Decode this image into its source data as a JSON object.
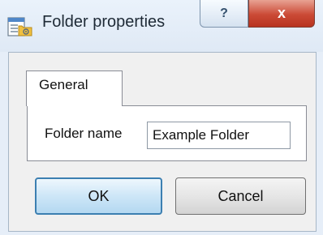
{
  "window": {
    "title": "Folder properties",
    "icon": "folder-properties-icon",
    "help_label": "?",
    "close_label": "x"
  },
  "tabs": [
    {
      "label": "General",
      "selected": true
    }
  ],
  "form": {
    "folder_name_label": "Folder name",
    "folder_name_value": "Example Folder"
  },
  "buttons": {
    "ok_label": "OK",
    "cancel_label": "Cancel"
  },
  "colors": {
    "title_bar": "#dfe9f5",
    "close_button": "#cb4a36",
    "default_button_border": "#3c7fb1"
  }
}
